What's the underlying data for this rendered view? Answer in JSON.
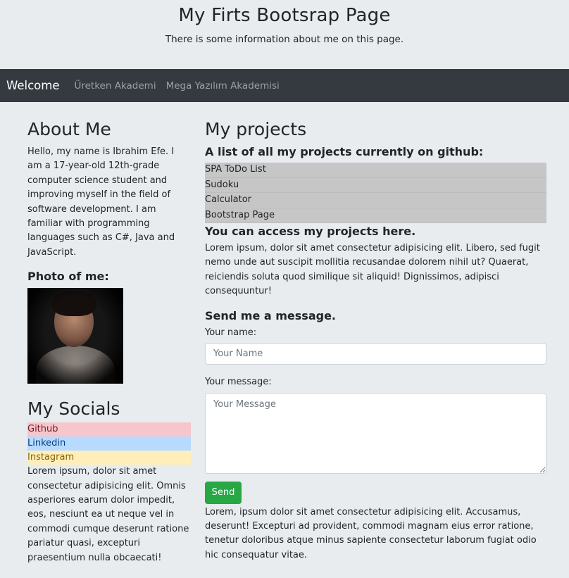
{
  "header": {
    "title": "My Firts Bootsrap Page",
    "subtitle": "There is some information about me on this page."
  },
  "navbar": {
    "brand": "Welcome",
    "links": [
      "Üretken Akademi",
      "Mega Yazılım Akademisi"
    ]
  },
  "about": {
    "heading": "About Me",
    "text": "Hello, my name is Ibrahim Efe. I am a 17-year-old 12th-grade computer science student and improving myself in the field of software development. I am familiar with programming languages such as C#, Java and JavaScript.",
    "photo_heading": "Photo of me:"
  },
  "socials": {
    "heading": "My Socials",
    "items": [
      {
        "label": "Github",
        "bg": "#f5c6cb",
        "color": "#721c24"
      },
      {
        "label": "Linkedin",
        "bg": "#b8daff",
        "color": "#004085"
      },
      {
        "label": "Instagram",
        "bg": "#ffeeba",
        "color": "#856404"
      }
    ],
    "text": "Lorem ipsum, dolor sit amet consectetur adipisicing elit. Omnis asperiores earum dolor impedit, eos, nesciunt ea ut neque vel in commodi cumque deserunt ratione pariatur quasi, excepturi praesentium nulla obcaecati!"
  },
  "projects": {
    "heading": "My projects",
    "subheading": "A list of all my projects currently on github:",
    "items": [
      "SPA ToDo List",
      "Sudoku",
      "Calculator",
      "Bootstrap Page"
    ],
    "access_heading": "You can access my projects here.",
    "access_text": "Lorem ipsum, dolor sit amet consectetur adipisicing elit. Libero, sed fugit nemo unde aut suscipit mollitia recusandae dolorem nihil ut? Quaerat, reiciendis soluta quod similique sit aliquid! Dignissimos, adipisci consequuntur!"
  },
  "contact": {
    "heading": "Send me a message.",
    "name_label": "Your name:",
    "name_placeholder": "Your Name",
    "message_label": "Your message:",
    "message_placeholder": "Your Message",
    "send_label": "Send",
    "footer_text": "Lorem, ipsum dolor sit amet consectetur adipisicing elit. Accusamus, deserunt! Excepturi ad provident, commodi magnam eius error ratione, tenetur doloribus atque minus sapiente consectetur laborum fugiat odio hic consequatur vitae."
  },
  "colors": {
    "background": "#e9ecef",
    "navbar": "#343a40",
    "send_button": "#28a745",
    "project_item": "#c6c6c6"
  }
}
